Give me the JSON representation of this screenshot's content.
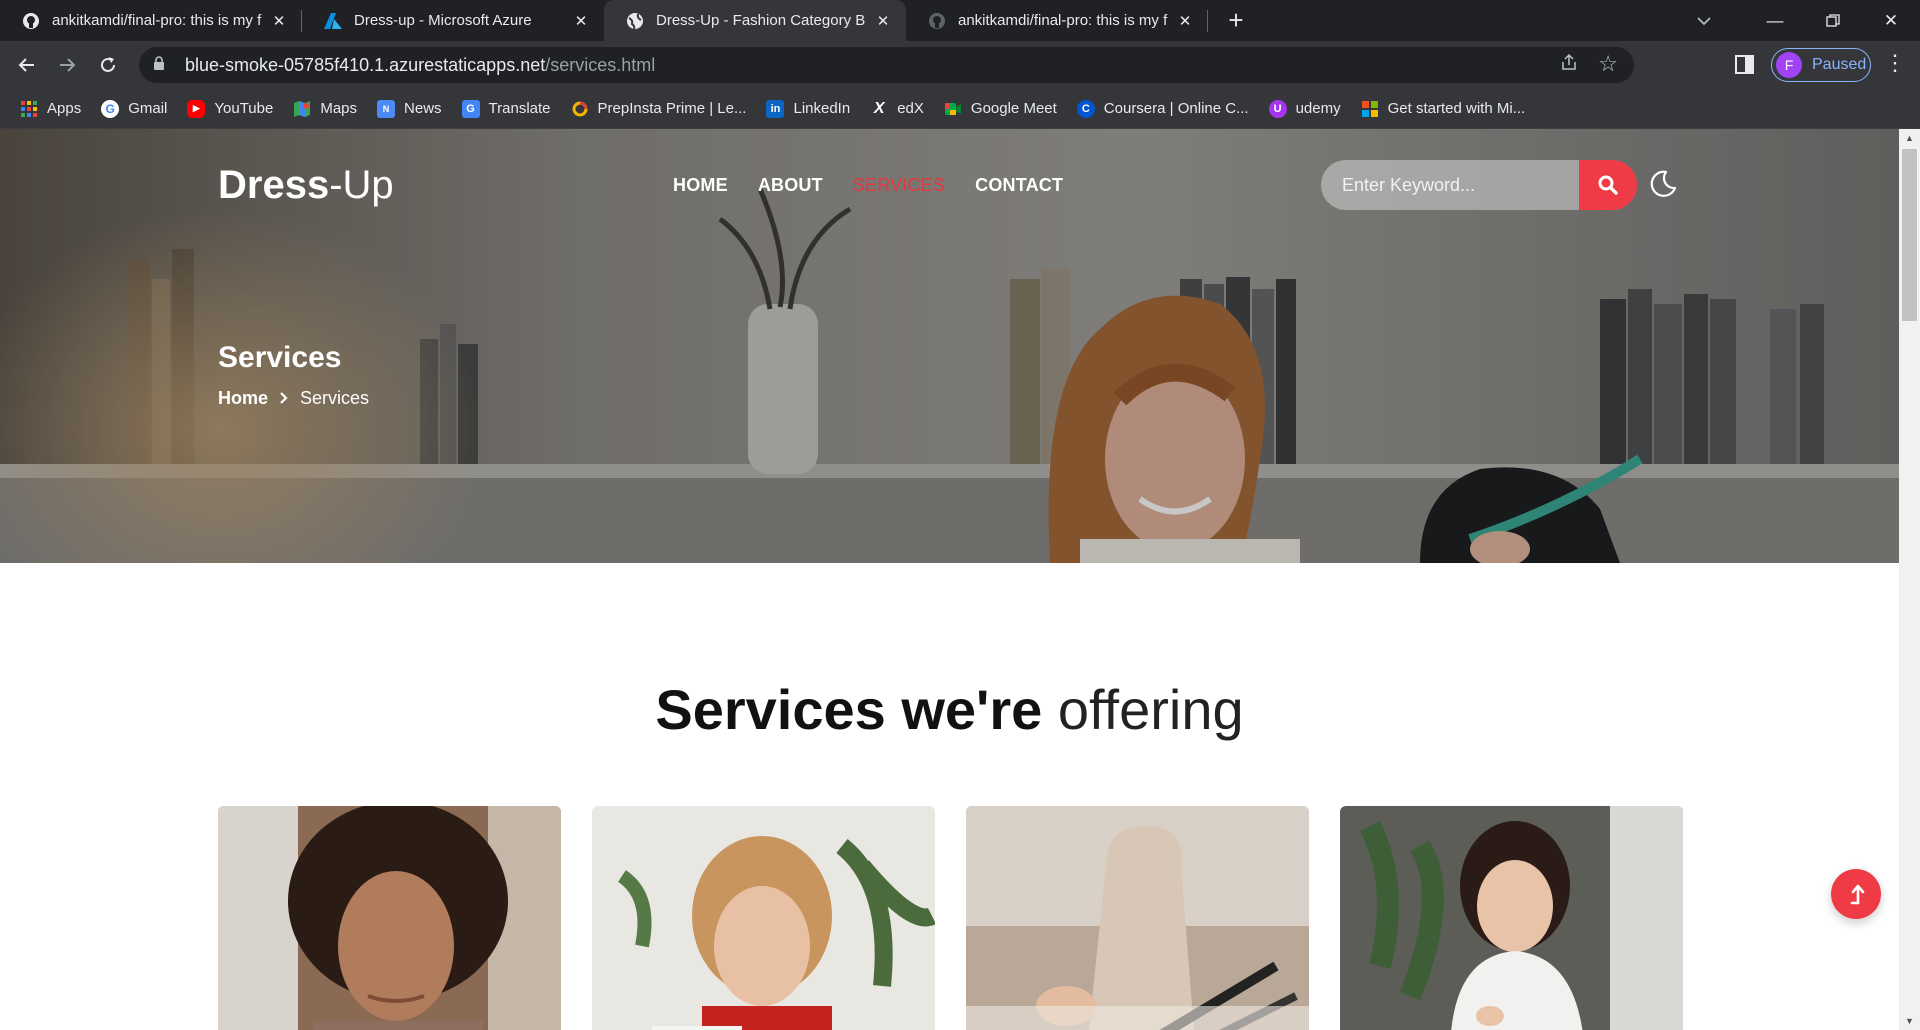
{
  "browser": {
    "tabs": [
      {
        "title": "ankitkamdi/final-pro: this is my fi",
        "icon": "github-icon",
        "active": false
      },
      {
        "title": "Dress-up - Microsoft Azure",
        "icon": "azure-icon",
        "active": false
      },
      {
        "title": "Dress-Up - Fashion Category Boo",
        "icon": "globe-icon",
        "active": true
      },
      {
        "title": "ankitkamdi/final-pro: this is my fi",
        "icon": "github-icon",
        "active": false
      }
    ],
    "url_host": "blue-smoke-05785f410.1.azurestaticapps.net",
    "url_path": "/services.html",
    "profile_initial": "F",
    "profile_status": "Paused",
    "bookmarks": [
      {
        "label": "Apps",
        "icon": "apps-grid-icon"
      },
      {
        "label": "Gmail",
        "icon": "google-icon"
      },
      {
        "label": "YouTube",
        "icon": "youtube-icon"
      },
      {
        "label": "Maps",
        "icon": "maps-icon"
      },
      {
        "label": "News",
        "icon": "news-icon"
      },
      {
        "label": "Translate",
        "icon": "translate-icon"
      },
      {
        "label": "PrepInsta Prime | Le...",
        "icon": "prepinsta-icon"
      },
      {
        "label": "LinkedIn",
        "icon": "linkedin-icon"
      },
      {
        "label": "edX",
        "icon": "edx-icon"
      },
      {
        "label": "Google Meet",
        "icon": "meet-icon"
      },
      {
        "label": "Coursera | Online C...",
        "icon": "coursera-icon"
      },
      {
        "label": "udemy",
        "icon": "udemy-icon"
      },
      {
        "label": "Get started with Mi...",
        "icon": "microsoft-icon"
      }
    ]
  },
  "site": {
    "logo_bold": "Dress",
    "logo_light": "-Up",
    "nav": [
      {
        "label": "HOME",
        "active": false
      },
      {
        "label": "ABOUT",
        "active": false
      },
      {
        "label": "SERVICES",
        "active": true
      },
      {
        "label": "CONTACT",
        "active": false
      }
    ],
    "search_placeholder": "Enter Keyword...",
    "accent_color": "#ef3b45",
    "hero": {
      "title": "Services",
      "breadcrumb_home": "Home",
      "breadcrumb_current": "Services"
    },
    "section": {
      "title_bold": "Services we're",
      "title_light": "offering"
    },
    "cards": [
      {
        "image": "woman-curly-hair-photo"
      },
      {
        "image": "woman-sewing-machine-photo"
      },
      {
        "image": "mannequin-scissors-photo"
      },
      {
        "image": "woman-sewing-by-hand-photo"
      }
    ]
  }
}
